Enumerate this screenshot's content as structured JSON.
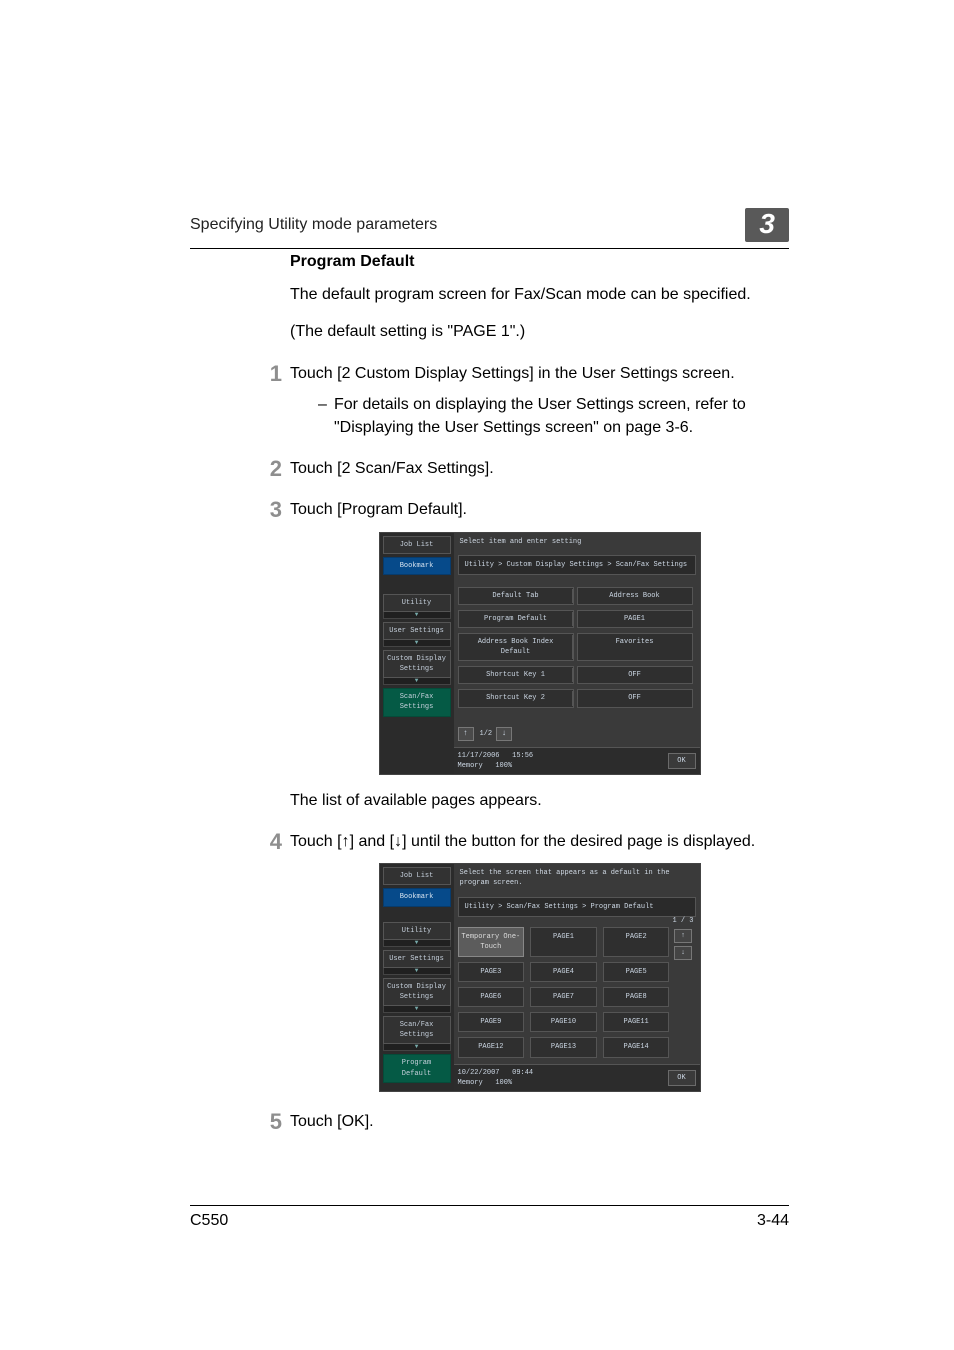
{
  "header": {
    "running_title": "Specifying Utility mode parameters",
    "chapter_number": "3"
  },
  "section": {
    "heading": "Program Default",
    "intro1": "The default program screen for Fax/Scan mode can be specified.",
    "intro2": "(The default setting is \"PAGE 1\".)"
  },
  "steps": {
    "s1": "Touch [2 Custom Display Settings] in the User Settings screen.",
    "s1_sub": "For details on displaying the User Settings screen, refer to \"Displaying the User Settings screen\" on page 3-6.",
    "s2": "Touch [2 Scan/Fax Settings].",
    "s3": "Touch [Program Default].",
    "s3_after": "The list of available pages appears.",
    "s4_pre": "Touch [",
    "s4_mid": "] and [",
    "s4_post": "] until the button for the desired page is displayed.",
    "s5": "Touch [OK]."
  },
  "screenshot1": {
    "header": "Select item and enter setting",
    "breadcrumb": "Utility > Custom Display Settings > Scan/Fax Settings",
    "left_tabs": {
      "job_list": "Job List",
      "bookmark": "Bookmark",
      "utility": "Utility",
      "user_settings": "User Settings",
      "custom_display": "Custom Display Settings",
      "scan_fax": "Scan/Fax Settings"
    },
    "rows": [
      {
        "label": "Default Tab",
        "value": "Address Book"
      },
      {
        "label": "Program Default",
        "value": "PAGE1"
      },
      {
        "label": "Address Book Index Default",
        "value": "Favorites"
      },
      {
        "label": "Shortcut Key 1",
        "value": "OFF"
      },
      {
        "label": "Shortcut Key 2",
        "value": "OFF"
      }
    ],
    "pager": {
      "up": "↑",
      "text": "1/2",
      "down": "↓"
    },
    "status": {
      "date": "11/17/2006",
      "time": "15:56",
      "memory_label": "Memory",
      "memory_value": "100%"
    },
    "ok": "OK"
  },
  "screenshot2": {
    "header": "Select the screen that appears as a default in the program screen.",
    "breadcrumb": "Utility > Scan/Fax Settings > Program Default",
    "left_tabs": {
      "job_list": "Job List",
      "bookmark": "Bookmark",
      "utility": "Utility",
      "user_settings": "User Settings",
      "custom_display": "Custom Display Settings",
      "scan_fax": "Scan/Fax Settings",
      "program_default": "Program Default"
    },
    "grid": [
      "Temporary One-Touch",
      "PAGE1",
      "PAGE2",
      "PAGE3",
      "PAGE4",
      "PAGE5",
      "PAGE6",
      "PAGE7",
      "PAGE8",
      "PAGE9",
      "PAGE10",
      "PAGE11",
      "PAGE12",
      "PAGE13",
      "PAGE14"
    ],
    "side_pager": {
      "text": "1 / 3",
      "up": "↑",
      "down": "↓"
    },
    "status": {
      "date": "10/22/2007",
      "time": "09:44",
      "memory_label": "Memory",
      "memory_value": "100%"
    },
    "ok": "OK"
  },
  "footer": {
    "model": "C550",
    "page": "3-44"
  },
  "glyphs": {
    "up": "↑",
    "down": "↓",
    "chev_down": "▼"
  }
}
